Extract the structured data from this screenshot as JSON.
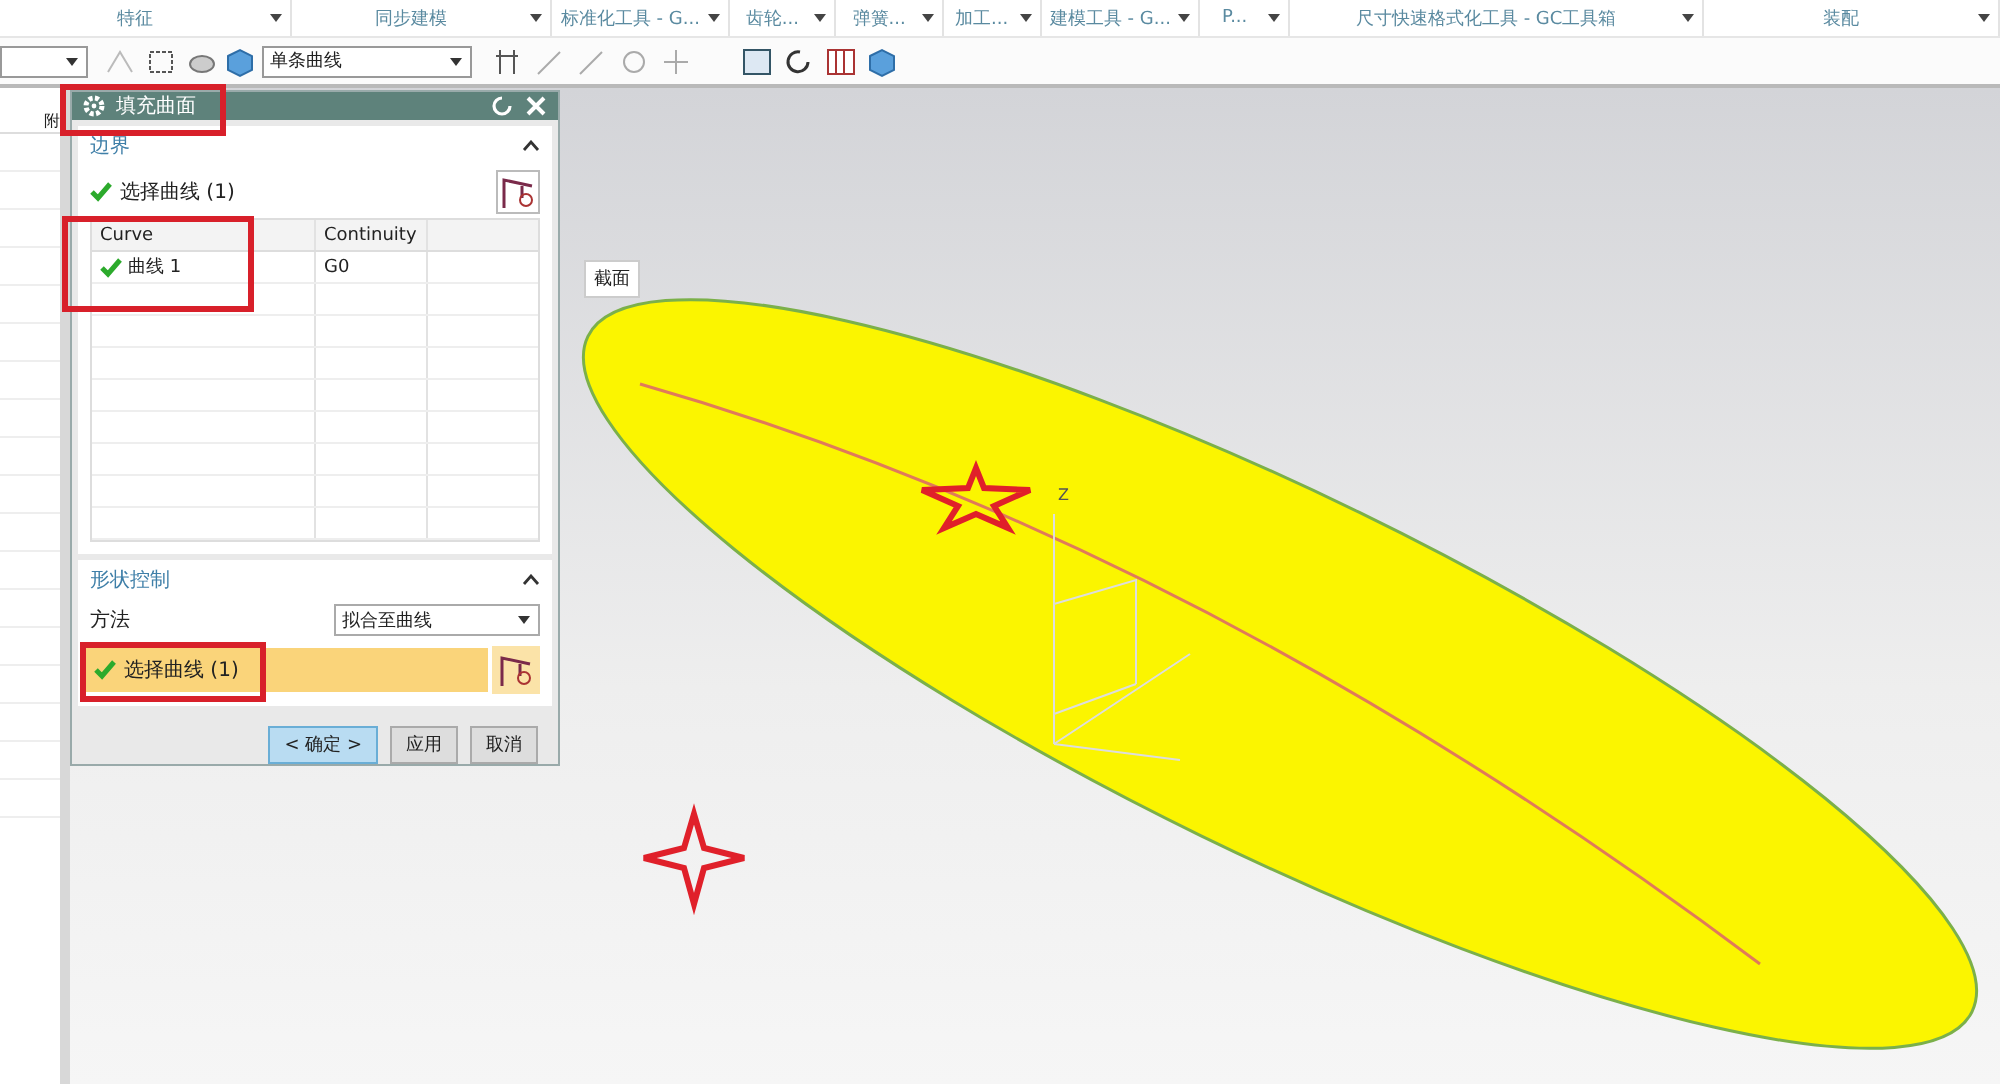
{
  "ribbon_groups": [
    {
      "label": "特征"
    },
    {
      "label": "同步建模"
    },
    {
      "label": "标准化工具 - G..."
    },
    {
      "label": "齿轮..."
    },
    {
      "label": "弹簧..."
    },
    {
      "label": "加工..."
    },
    {
      "label": "建模工具 - G..."
    },
    {
      "label": "P..."
    },
    {
      "label": "尺寸快速格式化工具 - GC工具箱"
    },
    {
      "label": "装配"
    }
  ],
  "toolbar": {
    "curve_rule": "单条曲线"
  },
  "navigator": {
    "column_header": "附"
  },
  "dialog": {
    "title": "填充曲面",
    "boundary": {
      "title": "边界",
      "expanded": true,
      "select_label": "选择曲线 (1)",
      "columns": [
        "Curve",
        "Continuity"
      ],
      "rows": [
        {
          "curve": "曲线 1",
          "continuity": "G0",
          "checked": true
        }
      ]
    },
    "shape_control": {
      "title": "形状控制",
      "expanded": true,
      "method_label": "方法",
      "method_value": "拟合至曲线",
      "select_label": "选择曲线 (1)",
      "selected": true
    },
    "buttons": [
      {
        "label": "< 确定 >",
        "kind": "default"
      },
      {
        "label": "应用",
        "kind": "normal"
      },
      {
        "label": "取消",
        "kind": "normal"
      }
    ]
  },
  "viewport": {
    "section_label": "截面",
    "axis_label": "Z"
  }
}
